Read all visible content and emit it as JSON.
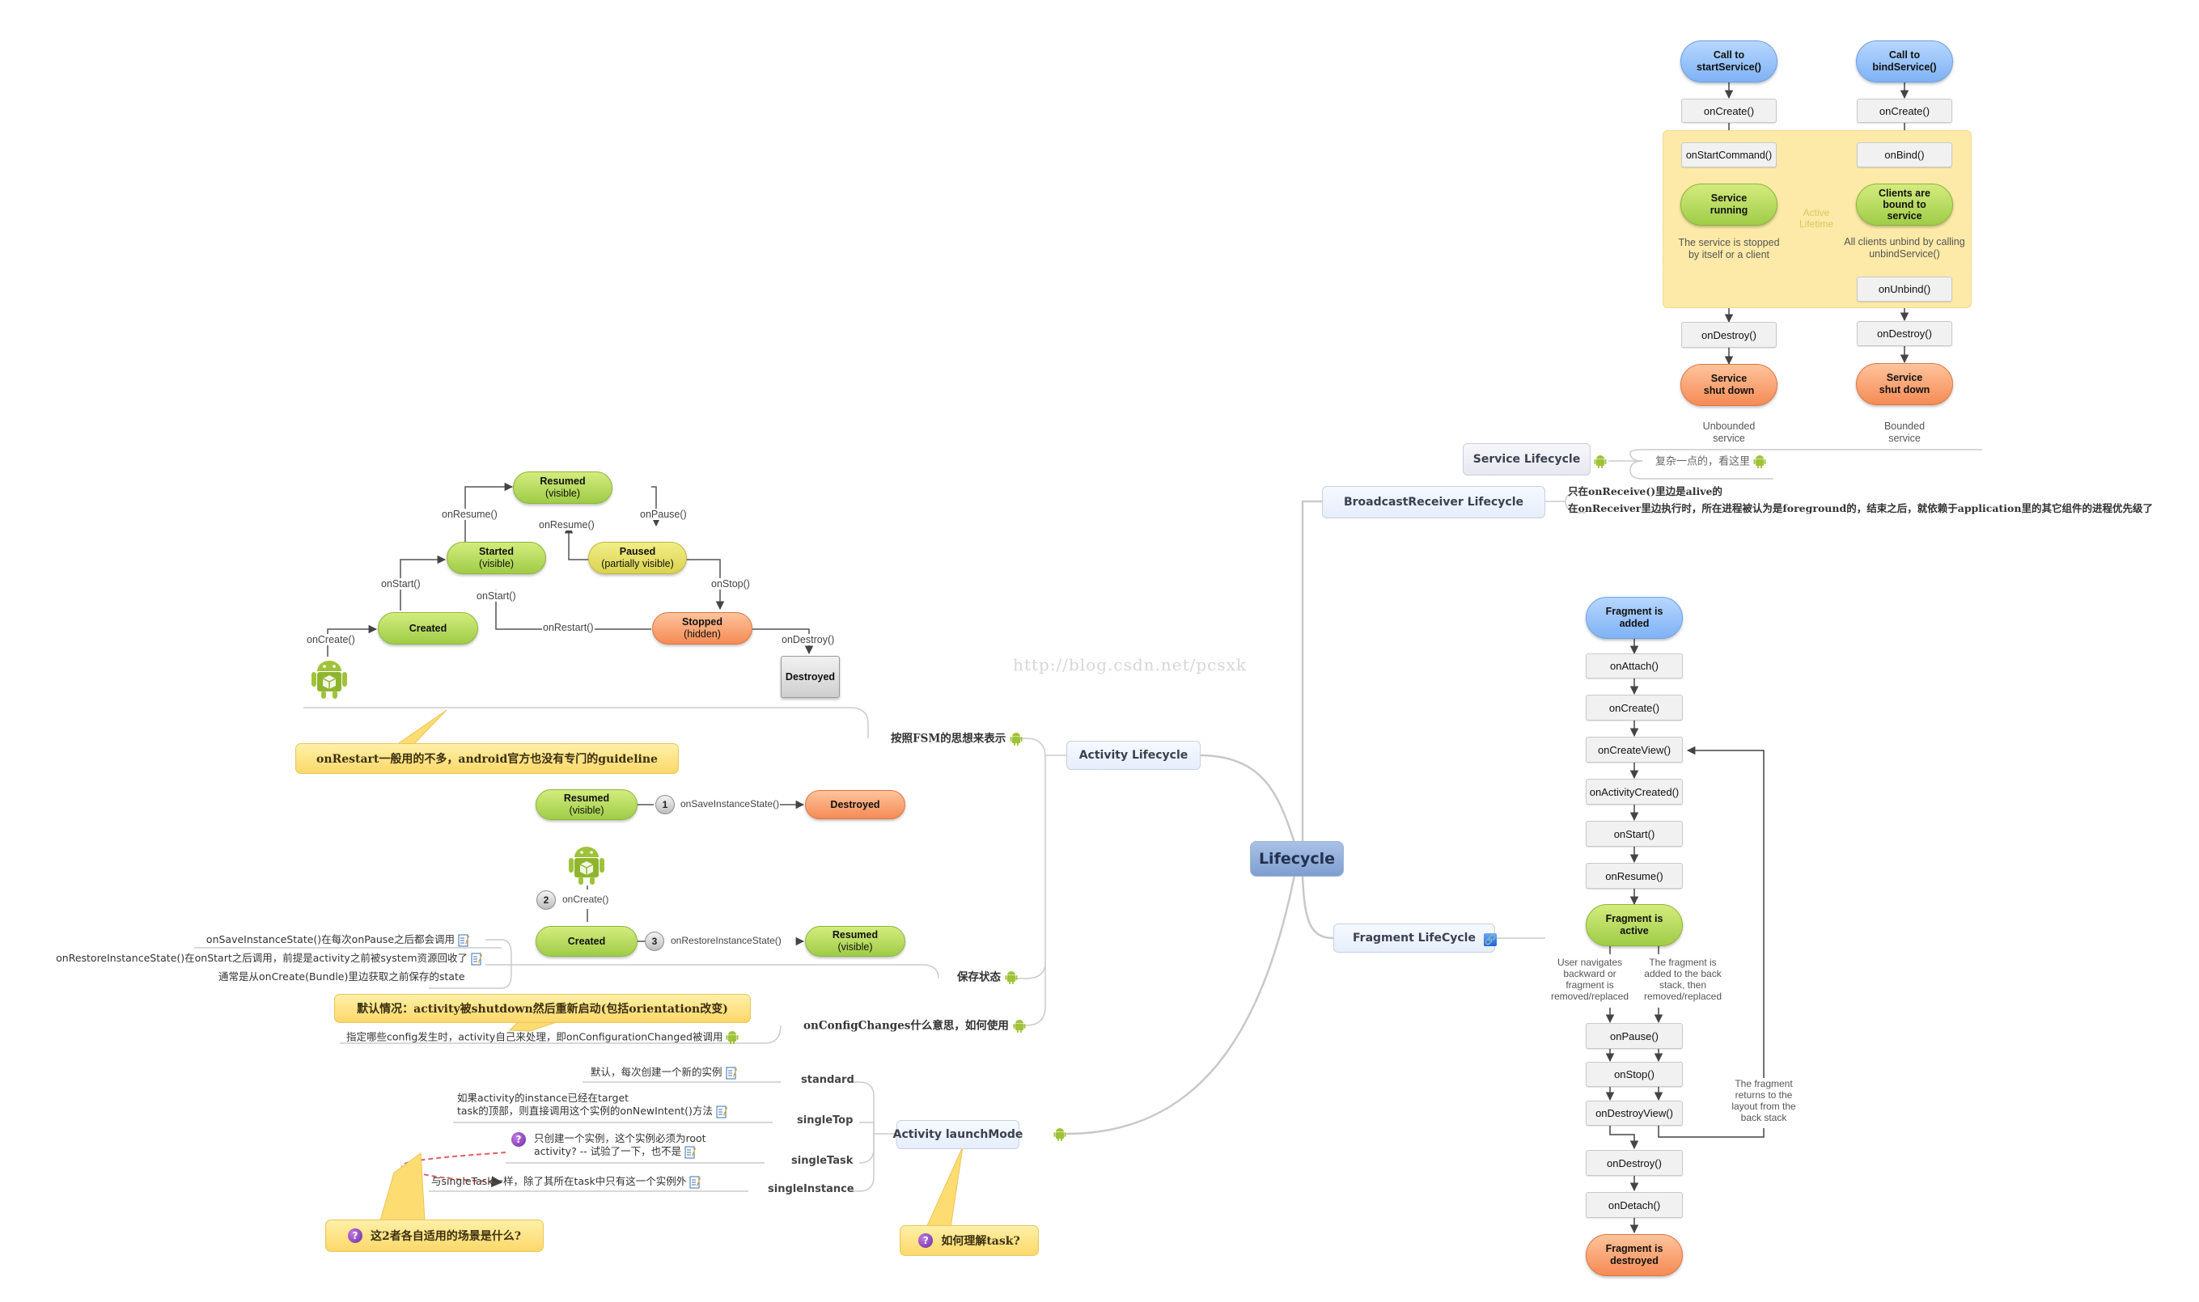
{
  "central": {
    "label": "Lifecycle"
  },
  "watermark": "http://blog.csdn.net/pcsxk",
  "colors": {
    "central": "#8aa8d8",
    "topic_bg": "#eaf1fd",
    "callout": "#fddc72",
    "android_green": "#9fc23a",
    "active_lifetime": "#fdeaa8",
    "green_state": "#b3d95a",
    "orange_state": "#f79a66",
    "blue_state": "#93bff8"
  },
  "service": {
    "topic": "Service Lifecycle",
    "note": "复杂一点的，看这里",
    "unbounded": {
      "start": "Call to\nstartService()",
      "steps": [
        "onCreate()",
        "onStartCommand()"
      ],
      "running": "Service\nrunning",
      "stop_note": "The service is stopped\nby itself or a client",
      "destroy": "onDestroy()",
      "end": "Service\nshut down",
      "caption": "Unbounded\nservice"
    },
    "bounded": {
      "start": "Call to\nbindService()",
      "steps": [
        "onCreate()",
        "onBind()"
      ],
      "running": "Clients are\nbound to\nservice",
      "stop_note": "All clients unbind by calling\nunbindService()",
      "unbind": "onUnbind()",
      "destroy": "onDestroy()",
      "end": "Service\nshut down",
      "caption": "Bounded\nservice"
    },
    "active_lifetime": "Active\nLifetime"
  },
  "broadcast": {
    "topic": "BroadcastReceiver Lifecycle",
    "notes": [
      "只在onReceive()里边是alive的",
      "在onReceiver里边执行时，所在进程被认为是foreground的，结束之后，就依赖于application里的其它组件的进程优先级了"
    ]
  },
  "activity": {
    "topic": "Activity Lifecycle",
    "branches": {
      "fsm": "按照FSM的思想来表示",
      "save_state": "保存状态",
      "config": "onConfigChanges什么意思，如何使用"
    },
    "fsm": {
      "states": {
        "resumed": {
          "title": "Resumed",
          "sub": "(visible)"
        },
        "started": {
          "title": "Started",
          "sub": "(visible)"
        },
        "paused": {
          "title": "Paused",
          "sub": "(partially visible)"
        },
        "created": {
          "title": "Created",
          "sub": ""
        },
        "stopped": {
          "title": "Stopped",
          "sub": "(hidden)"
        },
        "destroyed": {
          "title": "Destroyed",
          "sub": ""
        }
      },
      "transitions": {
        "onCreate": "onCreate()",
        "onStart": "onStart()",
        "onResume1": "onResume()",
        "onResume2": "onResume()",
        "onPause": "onPause()",
        "onStop": "onStop()",
        "onStart2": "onStart()",
        "onRestart": "onRestart()",
        "onDestroy": "onDestroy()"
      },
      "callout": "onRestart一般用的不多，android官方也没有专门的guideline"
    },
    "save": {
      "resumed": {
        "title": "Resumed",
        "sub": "(visible)"
      },
      "destroyed": "Destroyed",
      "created": "Created",
      "resumed2": {
        "title": "Resumed",
        "sub": "(visible)"
      },
      "step1": "1",
      "step1_label": "onSaveInstanceState()",
      "step2": "2",
      "step2_label": "onCreate()",
      "step3": "3",
      "step3_label": "onRestoreInstanceState()",
      "notes": [
        "onSaveInstanceState()在每次onPause之后都会调用",
        "onRestoreInstanceState()在onStart之后调用，前提是activity之前被system资源回收了",
        "通常是从onCreate(Bundle)里边获取之前保存的state"
      ]
    },
    "config": {
      "callout": "默认情况：activity被shutdown然后重新启动(包括orientation改变)",
      "note": "指定哪些config发生时，activity自己来处理，即onConfigurationChanged被调用"
    }
  },
  "launch_mode": {
    "topic": "Activity launchMode",
    "modes": [
      {
        "name": "standard",
        "note": "默认，每次创建一个新的实例"
      },
      {
        "name": "singleTop",
        "note": "如果activity的instance已经在target\ntask的顶部，则直接调用这个实例的onNewIntent()方法"
      },
      {
        "name": "singleTask",
        "note": "只创建一个实例，这个实例必须为root\nactivity? -- 试验了一下，也不是"
      },
      {
        "name": "singleInstance",
        "note": "与singleTask一样，除了其所在task中只有这一个实例外"
      }
    ],
    "callout_left": "这2者各自适用的场景是什么?",
    "callout_right": "如何理解task?"
  },
  "fragment": {
    "topic": "Fragment LifeCycle",
    "start": "Fragment is\nadded",
    "steps": [
      "onAttach()",
      "onCreate()",
      "onCreateView()",
      "onActivityCreated()",
      "onStart()",
      "onResume()"
    ],
    "active": "Fragment is\nactive",
    "note_left": "User navigates\nbackward or\nfragment is\nremoved/replaced",
    "note_right": "The fragment is\nadded to the back\nstack, then\nremoved/replaced",
    "teardown": [
      "onPause()",
      "onStop()",
      "onDestroyView()"
    ],
    "return_note": "The fragment\nreturns to the\nlayout from the\nback stack",
    "final_steps": [
      "onDestroy()",
      "onDetach()"
    ],
    "end": "Fragment is\ndestroyed"
  }
}
